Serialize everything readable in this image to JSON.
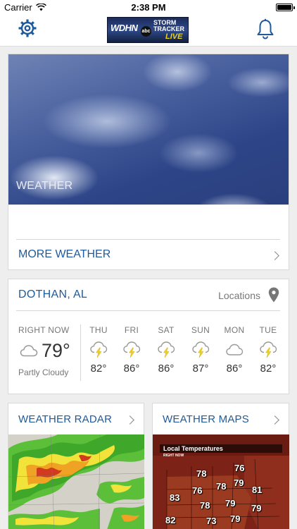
{
  "status_bar": {
    "carrier": "Carrier",
    "time": "2:38 PM"
  },
  "header": {
    "logo": {
      "text_station": "WDHN",
      "text_network": "abc",
      "text_storm": "STORM TRACKER",
      "text_live": "LIVE"
    },
    "settings_icon": "gear-icon",
    "notifications_icon": "bell-icon"
  },
  "hero": {
    "image_label": "WEATHER",
    "more_link": "MORE WEATHER"
  },
  "forecast": {
    "city": "DOTHAN, AL",
    "locations_label": "Locations",
    "current": {
      "label": "RIGHT NOW",
      "temp": "79°",
      "condition": "Partly Cloudy",
      "icon": "cloud-icon"
    },
    "days": [
      {
        "name": "THU",
        "temp": "82°",
        "icon": "thunderstorm-icon"
      },
      {
        "name": "FRI",
        "temp": "86°",
        "icon": "thunderstorm-icon"
      },
      {
        "name": "SAT",
        "temp": "86°",
        "icon": "thunderstorm-icon"
      },
      {
        "name": "SUN",
        "temp": "87°",
        "icon": "thunderstorm-icon"
      },
      {
        "name": "MON",
        "temp": "86°",
        "icon": "cloud-icon"
      },
      {
        "name": "TUE",
        "temp": "82°",
        "icon": "thunderstorm-icon"
      }
    ]
  },
  "tiles": {
    "radar": {
      "title": "WEATHER RADAR"
    },
    "maps": {
      "title": "WEATHER MAPS",
      "map_title": "Local Temperatures",
      "map_subtitle": "RIGHT NOW",
      "temps": [
        "78",
        "76",
        "79",
        "76",
        "78",
        "81",
        "83",
        "78",
        "79",
        "79",
        "82",
        "73",
        "79"
      ]
    }
  },
  "colors": {
    "accent": "#1e5a9c",
    "lightning": "#f2d21e",
    "background": "#eeeeee"
  }
}
